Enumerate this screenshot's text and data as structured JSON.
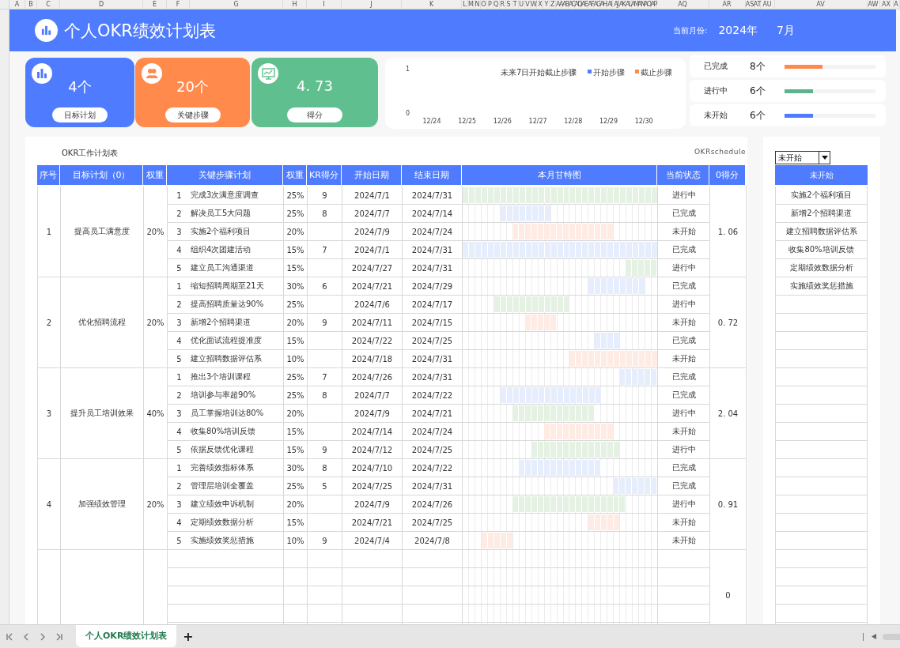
{
  "column_letters": [
    "A",
    "B",
    "C",
    "D",
    "E",
    "F",
    "G",
    "H",
    "I",
    "J",
    "K",
    "L",
    "M",
    "N",
    "O",
    "P",
    "Q",
    "R",
    "S",
    "T",
    "U",
    "V",
    "W",
    "X",
    "Y",
    "Z",
    "AA",
    "AB",
    "AC",
    "AD",
    "AE",
    "AF",
    "AG",
    "AH",
    "AI",
    "AJ",
    "AK",
    "AL",
    "AM",
    "AN",
    "AO",
    "AP",
    "AQ",
    "AR",
    "AS",
    "AT",
    "AU",
    "AV",
    "AW",
    "AX",
    "A"
  ],
  "banner": {
    "title": "个人OKR绩效计划表",
    "month_label": "当前月份:",
    "year": "2024年",
    "month": "7月"
  },
  "cards": [
    {
      "kind": "bars",
      "value": "4个",
      "label": "目标计划",
      "color": "#4f7cfe"
    },
    {
      "kind": "people",
      "value": "20个",
      "label": "关键步骤",
      "color": "#ff8a4c"
    },
    {
      "kind": "monitor",
      "value": "4. 73",
      "label": "得分",
      "color": "#5fbf8f"
    }
  ],
  "upcoming_chart": {
    "chart_data": {
      "type": "bar",
      "title": "未来7日开始截止步骤",
      "categories": [
        "12/24",
        "12/25",
        "12/26",
        "12/27",
        "12/28",
        "12/29",
        "12/30"
      ],
      "ylim": [
        0,
        1
      ],
      "yticks": [
        0,
        1
      ],
      "series": [
        {
          "name": "开始步骤",
          "color": "#4f7cfe",
          "values": [
            0,
            0,
            0,
            0,
            0,
            0,
            0
          ]
        },
        {
          "name": "截止步骤",
          "color": "#ff8a4c",
          "values": [
            0,
            0,
            0,
            0,
            0,
            0,
            0
          ]
        }
      ]
    }
  },
  "status_summary": [
    {
      "label": "已完成",
      "count": "8个",
      "level": 0.42,
      "color": "#ff8a4c"
    },
    {
      "label": "进行中",
      "count": "6个",
      "level": 0.31,
      "color": "#5fb38a"
    },
    {
      "label": "未开始",
      "count": "6个",
      "level": 0.31,
      "color": "#4f7cfe"
    }
  ],
  "table": {
    "caption": "OKR工作计划表",
    "code": "OKRschedule",
    "columns": [
      "序号",
      "目标计划（0）",
      "权重",
      "关键步骤计划",
      "权重",
      "KR得分",
      "开始日期",
      "结束日期",
      "本月甘特图",
      "当前状态",
      "0得分"
    ],
    "groups": [
      {
        "number": "1",
        "goal": "提高员工满意度",
        "weight": "20%",
        "score": "1. 06",
        "steps": [
          {
            "number": "1",
            "name": "完成3次满意度调查",
            "weight": "25%",
            "kr": "9",
            "start": "2024/7/1",
            "end": "2024/7/31",
            "status": "进行中",
            "color": "#e4f1e3"
          },
          {
            "number": "2",
            "name": "解决员工5大问题",
            "weight": "25%",
            "kr": "8",
            "start": "2024/7/7",
            "end": "2024/7/14",
            "status": "已完成",
            "color": "#e6edfc"
          },
          {
            "number": "3",
            "name": "实施2个福利项目",
            "weight": "20%",
            "start": "2024/7/9",
            "end": "2024/7/24",
            "status": "未开始",
            "color": "#fdebe4"
          },
          {
            "number": "4",
            "name": "组织4次团建活动",
            "weight": "15%",
            "kr": "7",
            "start": "2024/7/1",
            "end": "2024/7/31",
            "status": "已完成",
            "color": "#e6edfc"
          },
          {
            "number": "5",
            "name": "建立员工沟通渠道",
            "weight": "15%",
            "start": "2024/7/27",
            "end": "2024/7/31",
            "status": "进行中",
            "color": "#e4f1e3"
          }
        ]
      },
      {
        "number": "2",
        "goal": "优化招聘流程",
        "weight": "20%",
        "score": "0. 72",
        "steps": [
          {
            "number": "1",
            "name": "缩短招聘周期至21天",
            "weight": "30%",
            "kr": "6",
            "start": "2024/7/21",
            "end": "2024/7/29",
            "status": "已完成",
            "color": "#e6edfc"
          },
          {
            "number": "2",
            "name": "提高招聘质量达90%",
            "weight": "25%",
            "start": "2024/7/6",
            "end": "2024/7/17",
            "status": "进行中",
            "color": "#e4f1e3"
          },
          {
            "number": "3",
            "name": "新增2个招聘渠道",
            "weight": "20%",
            "kr": "9",
            "start": "2024/7/11",
            "end": "2024/7/15",
            "status": "未开始",
            "color": "#fdebe4"
          },
          {
            "number": "4",
            "name": "优化面试流程提准度",
            "weight": "15%",
            "start": "2024/7/22",
            "end": "2024/7/25",
            "status": "已完成",
            "color": "#e6edfc"
          },
          {
            "number": "5",
            "name": "建立招聘数据评估系",
            "weight": "10%",
            "start": "2024/7/18",
            "end": "2024/7/31",
            "status": "未开始",
            "color": "#fdebe4"
          }
        ]
      },
      {
        "number": "3",
        "goal": "提升员工培训效果",
        "weight": "40%",
        "score": "2. 04",
        "steps": [
          {
            "number": "1",
            "name": "推出3个培训课程",
            "weight": "25%",
            "kr": "7",
            "start": "2024/7/26",
            "end": "2024/7/31",
            "status": "已完成",
            "color": "#e6edfc"
          },
          {
            "number": "2",
            "name": "培训参与率超90%",
            "weight": "25%",
            "kr": "8",
            "start": "2024/7/7",
            "end": "2024/7/22",
            "status": "已完成",
            "color": "#e6edfc"
          },
          {
            "number": "3",
            "name": "员工掌握培训达80%",
            "weight": "20%",
            "start": "2024/7/9",
            "end": "2024/7/21",
            "status": "进行中",
            "color": "#e4f1e3"
          },
          {
            "number": "4",
            "name": "收集80%培训反馈",
            "weight": "15%",
            "start": "2024/7/14",
            "end": "2024/7/24",
            "status": "未开始",
            "color": "#fdebe4"
          },
          {
            "number": "5",
            "name": "依据反馈优化课程",
            "weight": "15%",
            "kr": "9",
            "start": "2024/7/12",
            "end": "2024/7/25",
            "status": "进行中",
            "color": "#e4f1e3"
          }
        ]
      },
      {
        "number": "4",
        "goal": "加强绩效管理",
        "weight": "20%",
        "score": "0. 91",
        "steps": [
          {
            "number": "1",
            "name": "完善绩效指标体系",
            "weight": "30%",
            "kr": "8",
            "start": "2024/7/10",
            "end": "2024/7/22",
            "status": "已完成",
            "color": "#e6edfc"
          },
          {
            "number": "2",
            "name": "管理层培训全覆盖",
            "weight": "25%",
            "kr": "5",
            "start": "2024/7/25",
            "end": "2024/7/31",
            "status": "已完成",
            "color": "#e6edfc"
          },
          {
            "number": "3",
            "name": "建立绩效申诉机制",
            "weight": "20%",
            "start": "2024/7/9",
            "end": "2024/7/26",
            "status": "进行中",
            "color": "#e4f1e3"
          },
          {
            "number": "4",
            "name": "定期绩效数据分析",
            "weight": "15%",
            "start": "2024/7/21",
            "end": "2024/7/25",
            "status": "未开始",
            "color": "#fdebe4"
          },
          {
            "number": "5",
            "name": "实施绩效奖惩措施",
            "weight": "10%",
            "kr": "9",
            "start": "2024/7/4",
            "end": "2024/7/8",
            "status": "未开始",
            "color": "#fdebe4"
          }
        ]
      },
      {
        "score": "0"
      }
    ]
  },
  "filter": {
    "value": "未开始",
    "header": "未开始",
    "items": [
      "实施2个福利项目",
      "新增2个招聘渠道",
      "建立招聘数据评估系",
      "收集80%培训反馈",
      "定期绩效数据分析",
      "实施绩效奖惩措施"
    ]
  },
  "sheet_tabs": [
    {
      "label": "个人OKR绩效计划表",
      "selected": true
    }
  ],
  "add_sheet": "+"
}
